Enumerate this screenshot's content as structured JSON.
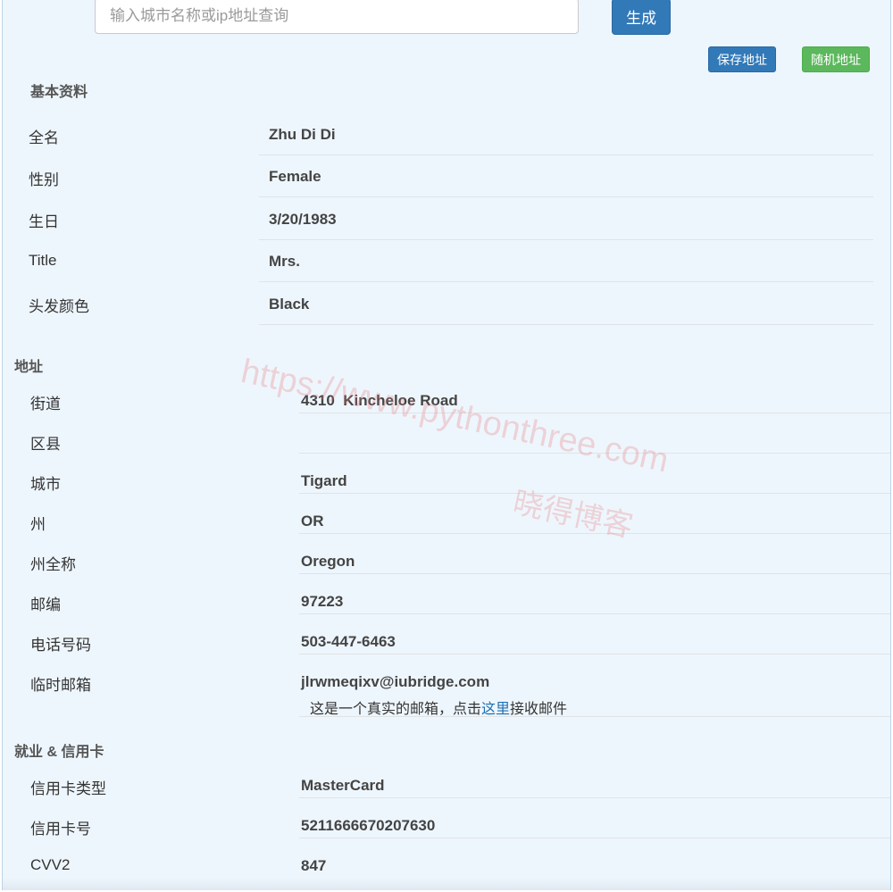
{
  "search": {
    "placeholder": "输入城市名称或ip地址查询",
    "button_label": "生成"
  },
  "actions": {
    "save_label": "保存地址",
    "random_label": "随机地址"
  },
  "basic": {
    "title": "基本资料",
    "rows": [
      {
        "label": "全名",
        "value": "Zhu Di Di"
      },
      {
        "label": "性别",
        "value": "Female"
      },
      {
        "label": "生日",
        "value": "3/20/1983"
      },
      {
        "label": "Title",
        "value": "Mrs."
      },
      {
        "label": "头发颜色",
        "value": "Black"
      }
    ]
  },
  "address": {
    "title": "地址",
    "rows": [
      {
        "label": "街道",
        "value": "4310  Kincheloe Road"
      },
      {
        "label": "区县",
        "value": ""
      },
      {
        "label": "城市",
        "value": "Tigard"
      },
      {
        "label": "州",
        "value": "OR"
      },
      {
        "label": "州全称",
        "value": "Oregon"
      },
      {
        "label": "邮编",
        "value": "97223"
      },
      {
        "label": "电话号码",
        "value": "503-447-6463"
      },
      {
        "label": "临时邮箱",
        "value": "jlrwmeqixv@iubridge.com"
      }
    ],
    "email_note_prefix": "这是一个真实的邮箱，点击",
    "email_note_link": "这里",
    "email_note_suffix": "接收邮件"
  },
  "employment": {
    "title": "就业 & 信用卡",
    "rows": [
      {
        "label": "信用卡类型",
        "value": "MasterCard"
      },
      {
        "label": "信用卡号",
        "value": "5211666670207630"
      },
      {
        "label": "CVV2",
        "value": "847"
      }
    ]
  },
  "watermark": {
    "url": "https://www.pythonthree.com",
    "name": "晓得博客"
  }
}
